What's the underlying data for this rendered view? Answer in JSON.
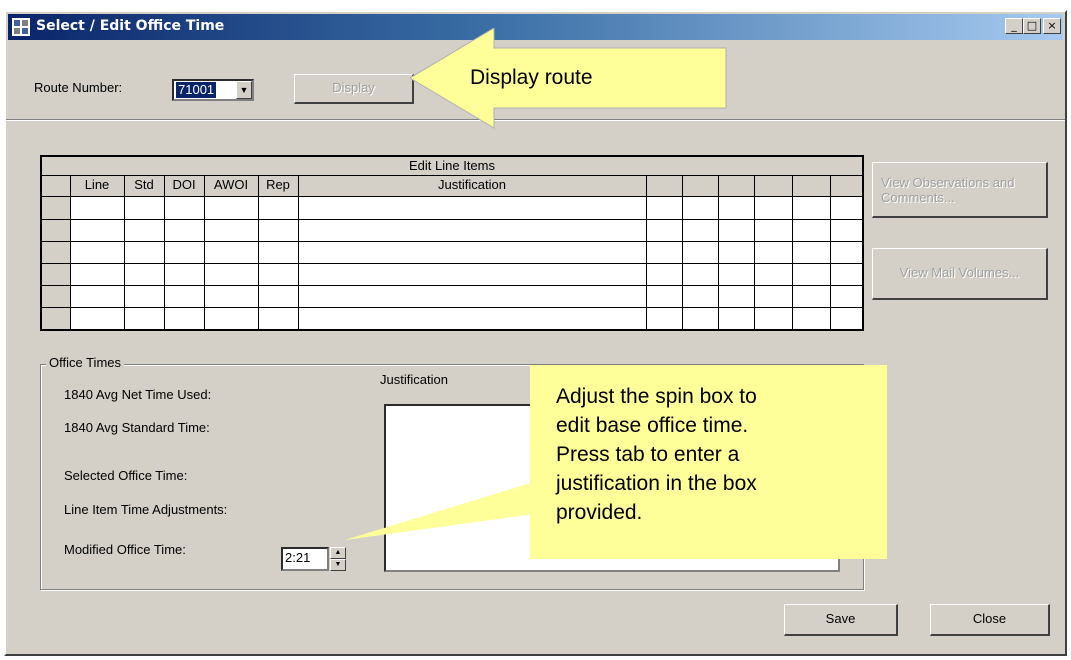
{
  "window": {
    "title": "Select / Edit Office Time",
    "min_glyph": "_",
    "max_glyph": "□",
    "close_glyph": "×"
  },
  "route": {
    "label": "Route Number:",
    "value": "71001",
    "arrow_glyph": "▼"
  },
  "display_button": "Display",
  "grid": {
    "title": "Edit Line Items",
    "columns": [
      "Line",
      "Std",
      "DOI",
      "AWOI",
      "Rep",
      "Justification",
      "",
      "",
      "",
      "",
      "",
      ""
    ]
  },
  "side_buttons": {
    "observations": "View Observations and Comments...",
    "mail_volumes": "View Mail Volumes..."
  },
  "office_times": {
    "group_title": "Office Times",
    "labels": [
      "1840 Avg Net Time Used:",
      "1840 Avg Standard Time:",
      "Selected Office Time:",
      "Line Item Time Adjustments:",
      "Modified Office Time:"
    ],
    "justification_label": "Justification",
    "modified_value": "2:21",
    "spin_up": "▲",
    "spin_down": "▼"
  },
  "footer": {
    "save": "Save",
    "close": "Close"
  },
  "callouts": {
    "display_route": "Display route",
    "spin_box_lines": [
      "Adjust the spin box to",
      "edit base office time.",
      "Press tab to enter a",
      "justification in the box",
      "provided."
    ]
  },
  "colors": {
    "titlebar": "#0a246a",
    "window_bg": "#d4d0c8",
    "callout_bg": "#ffff99",
    "selection": "#0a246a"
  }
}
